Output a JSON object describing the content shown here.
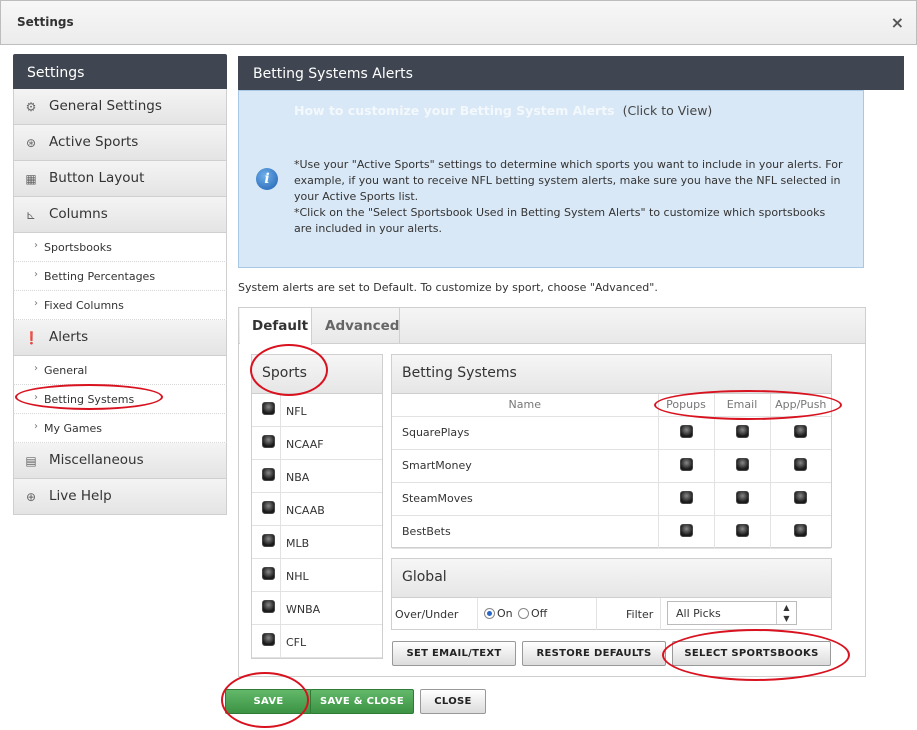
{
  "window": {
    "title": "Settings",
    "close_glyph": "×"
  },
  "sidebar": {
    "header": "Settings",
    "items": [
      {
        "label": "General Settings",
        "icon": "gear-icon",
        "glyph": "⚙"
      },
      {
        "label": "Active Sports",
        "icon": "basketball-icon",
        "glyph": "⊛"
      },
      {
        "label": "Button Layout",
        "icon": "grid-icon",
        "glyph": "▦"
      },
      {
        "label": "Columns",
        "icon": "chart-icon",
        "glyph": "⊾"
      },
      {
        "label": "Sportsbooks"
      },
      {
        "label": "Betting Percentages"
      },
      {
        "label": "Fixed Columns"
      },
      {
        "label": "Alerts",
        "icon": "alert-icon",
        "glyph": "❗"
      },
      {
        "label": "General"
      },
      {
        "label": "Betting Systems"
      },
      {
        "label": "My Games"
      },
      {
        "label": "Miscellaneous",
        "icon": "misc-icon",
        "glyph": "▤"
      },
      {
        "label": "Live Help",
        "icon": "lifebuoy-icon",
        "glyph": "⊕"
      }
    ]
  },
  "main": {
    "header": "Betting Systems Alerts",
    "info": {
      "howto_link": "How to customize your  Betting System Alerts",
      "click_hint": "(Click to View)",
      "icon_glyph": "i",
      "line1": "*Use your \"Active Sports\" settings to determine which sports you want to include in your alerts. For example, if you want to receive NFL betting system alerts, make sure you have the NFL selected in your Active Sports list.",
      "line2": "*Click on the \"Select Sportsbook Used in Betting System Alerts\" to customize which sportsbooks are included in your alerts."
    },
    "notice": "System alerts are set to Default. To customize by sport, choose \"Advanced\".",
    "tabs": [
      "Default",
      "Advanced"
    ],
    "sports": {
      "header": "Sports",
      "list": [
        "NFL",
        "NCAAF",
        "NBA",
        "NCAAB",
        "MLB",
        "NHL",
        "WNBA",
        "CFL"
      ]
    },
    "betting_systems": {
      "header": "Betting Systems",
      "columns": [
        "Name",
        "Popups",
        "Email",
        "App/Push"
      ],
      "rows": [
        "SquarePlays",
        "SmartMoney",
        "SteamMoves",
        "BestBets"
      ]
    },
    "global": {
      "header": "Global",
      "over_under_label": "Over/Under",
      "radio_on": "On",
      "radio_off": "Off",
      "filter_label": "Filter",
      "filter_value": "All Picks",
      "select_arrows": "▲\n▼"
    },
    "buttons": {
      "set_email": "SET EMAIL/TEXT",
      "restore": "RESTORE DEFAULTS",
      "select_books": "SELECT SPORTSBOOKS"
    }
  },
  "footer": {
    "save": "SAVE",
    "save_close": "SAVE & CLOSE",
    "close": "CLOSE"
  },
  "colors": {
    "header_bg": "#3f4651",
    "info_bg": "#d9e8f6",
    "save_green": "#4ca653",
    "annotation_red": "#d8121f"
  }
}
